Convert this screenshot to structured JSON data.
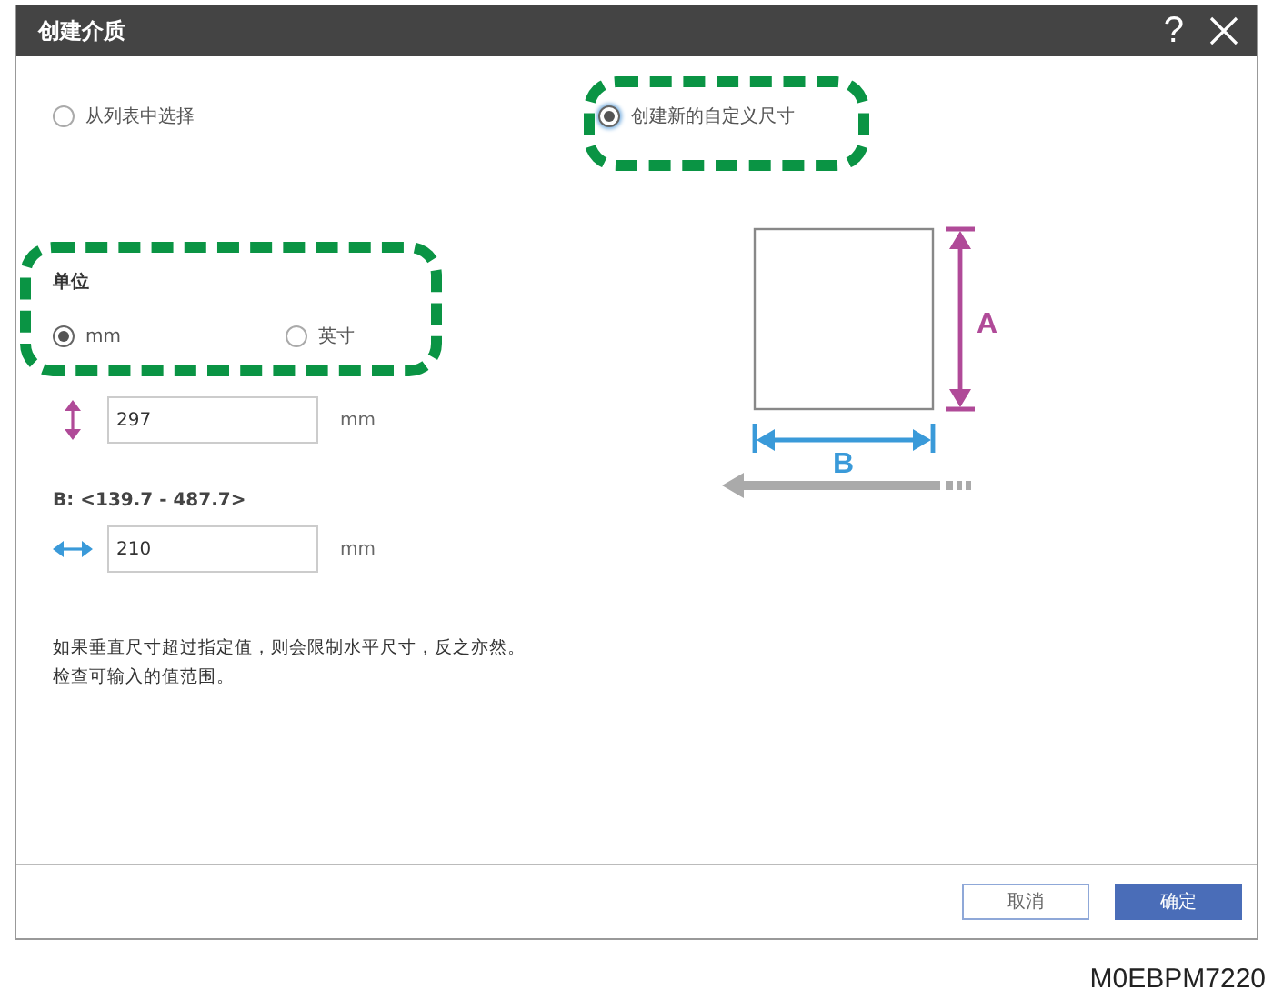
{
  "window": {
    "title": "创建介质",
    "help": "?"
  },
  "source_options": [
    {
      "label": "从列表中选择",
      "selected": false
    },
    {
      "label": "创建新的自定义尺寸",
      "selected": true
    }
  ],
  "unit": {
    "label": "单位",
    "options": [
      {
        "label": "mm",
        "selected": true
      },
      {
        "label": "英寸",
        "selected": false
      }
    ]
  },
  "height_field": {
    "value": "297",
    "unit": "mm"
  },
  "width_range": "B: <139.7 - 487.7>",
  "width_field": {
    "value": "210",
    "unit": "mm"
  },
  "note": [
    "如果垂直尺寸超过指定值，则会限制水平尺寸，反之亦然。",
    "检查可输入的值范围。"
  ],
  "diagram": {
    "label_a": "A",
    "label_b": "B"
  },
  "buttons": [
    {
      "label": "取消",
      "kind": "secondary"
    },
    {
      "label": "确定",
      "kind": "primary"
    }
  ],
  "figure_code": "M0EBPM7220"
}
